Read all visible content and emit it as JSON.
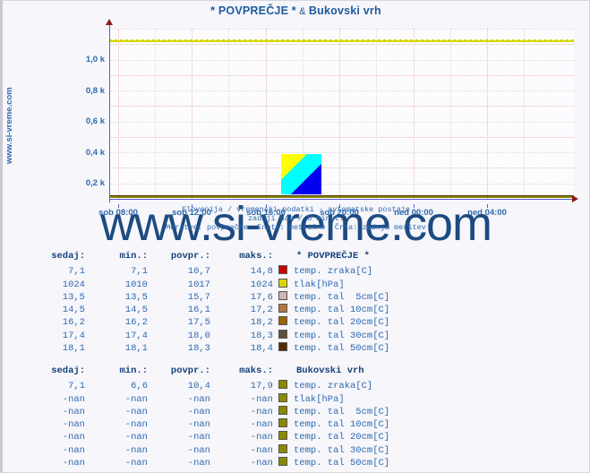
{
  "page": {
    "background_color": "#f6f6fb",
    "title": "* POVPREČJE * & Bukovski vrh",
    "title_main": "* POVPREČJE *",
    "title_amp": " & ",
    "title_second": "Bukovski vrh",
    "side_label": "www.si-vreme.com",
    "watermark": "www.si-vreme.com"
  },
  "caption": {
    "line1": "Slovenija / vremenski podatki - avtomatske postaje",
    "line2": "zadnji dan / 5 minut.",
    "line3": "Meritve: povprečne  Enote: metrične  Črta: zadnja meritev"
  },
  "chart_data": {
    "type": "line",
    "title": "* POVPREČJE * & Bukovski vrh",
    "xlabel": "",
    "ylabel": "",
    "ylim": [
      0,
      1100
    ],
    "grid": true,
    "legend_position": "below",
    "y_ticks": [
      "0,2 k",
      "0,4 k",
      "0,6 k",
      "0,8 k",
      "1,0 k"
    ],
    "y_tick_values": [
      200,
      400,
      600,
      800,
      1000
    ],
    "x_ticks": [
      "sob 08:00",
      "sob 12:00",
      "sob 16:00",
      "sob 20:00",
      "ned 00:00",
      "ned 04:00"
    ],
    "series": [
      {
        "name": "tlak[hPa] (* POVPREČJE *)",
        "color": "#d9d900",
        "value": 1017,
        "style": "solid"
      },
      {
        "name": "tlak[hPa] (dashed upper)",
        "color": "#d4d400",
        "value": 1024,
        "style": "dashed"
      },
      {
        "name": "temp. zraka[C] (* POVPREČJE *)",
        "color": "#cc0000",
        "value": 10.7,
        "style": "dashed"
      },
      {
        "name": "temp. tal 5cm[C]",
        "color": "#d4b4b4",
        "value": 15.7,
        "style": "solid"
      },
      {
        "name": "temp. tal 10cm[C]",
        "color": "#b4783c",
        "value": 16.1,
        "style": "solid"
      },
      {
        "name": "temp. tal 20cm[C]",
        "color": "#9c6400",
        "value": 17.5,
        "style": "solid"
      },
      {
        "name": "temp. tal 30cm[C]",
        "color": "#5c5038",
        "value": 18.0,
        "style": "solid"
      },
      {
        "name": "temp. tal 50cm[C]",
        "color": "#4d2e00",
        "value": 18.3,
        "style": "solid"
      },
      {
        "name": "temp. zraka[C] (Bukovski vrh)",
        "color": "#8a8a00",
        "value": 10.4,
        "style": "solid"
      }
    ]
  },
  "table1": {
    "headers": [
      "sedaj:",
      "min.:",
      "povpr.:",
      "maks.:"
    ],
    "station": "* POVPREČJE *",
    "rows": [
      {
        "sedaj": "7,1",
        "min": "7,1",
        "povpr": "10,7",
        "maks": "14,8",
        "color": "#cc0000",
        "label": "temp. zraka[C]"
      },
      {
        "sedaj": "1024",
        "min": "1010",
        "povpr": "1017",
        "maks": "1024",
        "color": "#d9d900",
        "label": "tlak[hPa]"
      },
      {
        "sedaj": "13,5",
        "min": "13,5",
        "povpr": "15,7",
        "maks": "17,6",
        "color": "#d4b4b4",
        "label": "temp. tal  5cm[C]"
      },
      {
        "sedaj": "14,5",
        "min": "14,5",
        "povpr": "16,1",
        "maks": "17,2",
        "color": "#b4783c",
        "label": "temp. tal 10cm[C]"
      },
      {
        "sedaj": "16,2",
        "min": "16,2",
        "povpr": "17,5",
        "maks": "18,2",
        "color": "#9c6400",
        "label": "temp. tal 20cm[C]"
      },
      {
        "sedaj": "17,4",
        "min": "17,4",
        "povpr": "18,0",
        "maks": "18,3",
        "color": "#5c5038",
        "label": "temp. tal 30cm[C]"
      },
      {
        "sedaj": "18,1",
        "min": "18,1",
        "povpr": "18,3",
        "maks": "18,4",
        "color": "#4d2e00",
        "label": "temp. tal 50cm[C]"
      }
    ]
  },
  "table2": {
    "headers": [
      "sedaj:",
      "min.:",
      "povpr.:",
      "maks.:"
    ],
    "station": "Bukovski vrh",
    "rows": [
      {
        "sedaj": "7,1",
        "min": "6,6",
        "povpr": "10,4",
        "maks": "17,9",
        "color": "#8a8a00",
        "label": "temp. zraka[C]"
      },
      {
        "sedaj": "-nan",
        "min": "-nan",
        "povpr": "-nan",
        "maks": "-nan",
        "color": "#8a8a00",
        "label": "tlak[hPa]"
      },
      {
        "sedaj": "-nan",
        "min": "-nan",
        "povpr": "-nan",
        "maks": "-nan",
        "color": "#8a8a00",
        "label": "temp. tal  5cm[C]"
      },
      {
        "sedaj": "-nan",
        "min": "-nan",
        "povpr": "-nan",
        "maks": "-nan",
        "color": "#8a8a00",
        "label": "temp. tal 10cm[C]"
      },
      {
        "sedaj": "-nan",
        "min": "-nan",
        "povpr": "-nan",
        "maks": "-nan",
        "color": "#8a8a00",
        "label": "temp. tal 20cm[C]"
      },
      {
        "sedaj": "-nan",
        "min": "-nan",
        "povpr": "-nan",
        "maks": "-nan",
        "color": "#8a8a00",
        "label": "temp. tal 30cm[C]"
      },
      {
        "sedaj": "-nan",
        "min": "-nan",
        "povpr": "-nan",
        "maks": "-nan",
        "color": "#8a8a00",
        "label": "temp. tal 50cm[C]"
      }
    ]
  }
}
